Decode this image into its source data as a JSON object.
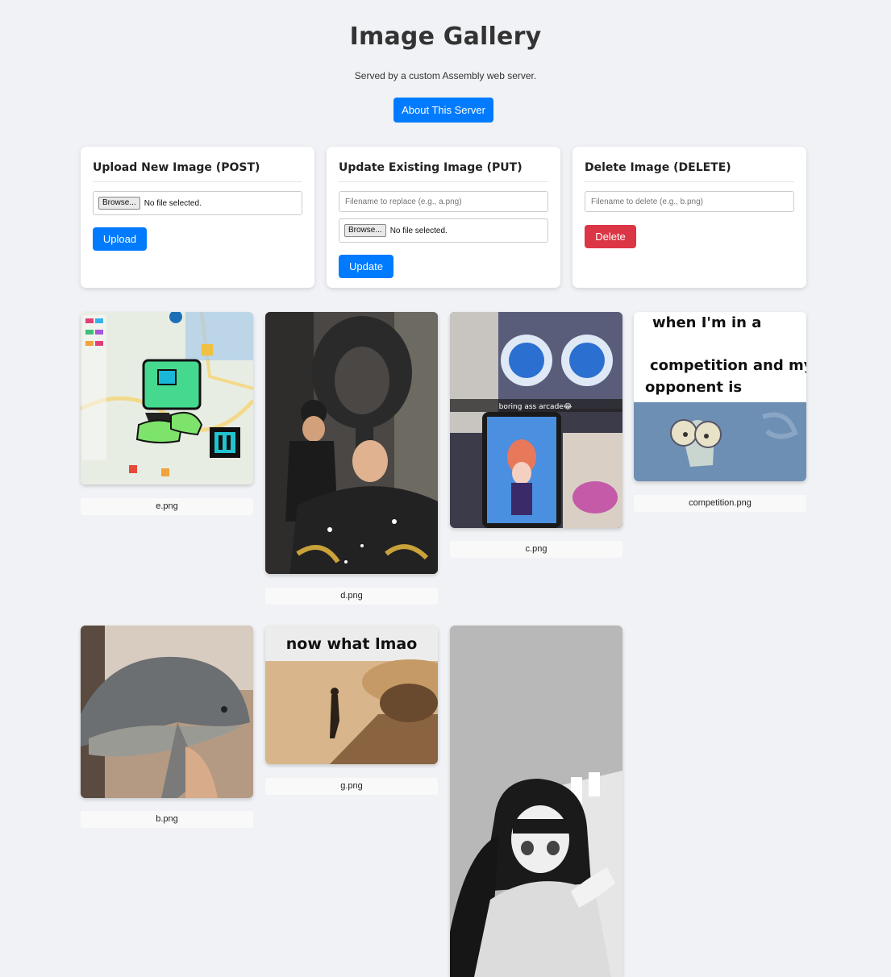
{
  "header": {
    "title": "Image Gallery",
    "subtitle": "Served by a custom Assembly web server.",
    "about_label": "About This Server"
  },
  "upload": {
    "heading": "Upload New Image (POST)",
    "browse_label": "Browse...",
    "file_status": "No file selected.",
    "button_label": "Upload"
  },
  "update": {
    "heading": "Update Existing Image (PUT)",
    "filename_placeholder": "Filename to replace (e.g., a.png)",
    "browse_label": "Browse...",
    "file_status": "No file selected.",
    "button_label": "Update"
  },
  "delete": {
    "heading": "Delete Image (DELETE)",
    "filename_placeholder": "Filename to delete (e.g., b.png)",
    "button_label": "Delete"
  },
  "gallery": {
    "images": [
      {
        "filename": "e.png"
      },
      {
        "filename": "d.png"
      },
      {
        "filename": "c.png",
        "overlay_text": "boring ass arcade😂"
      },
      {
        "filename": "competition.png",
        "meme_text_1": "when I'm in a",
        "meme_text_2": "competition and my",
        "meme_text_3": "opponent is"
      },
      {
        "filename": "b.png"
      },
      {
        "filename": "g.png",
        "meme_text_1": "now what lmao"
      },
      {
        "filename": ""
      }
    ]
  },
  "colors": {
    "background": "#f0f2f5",
    "primary": "#007bff",
    "danger": "#dc3545"
  }
}
